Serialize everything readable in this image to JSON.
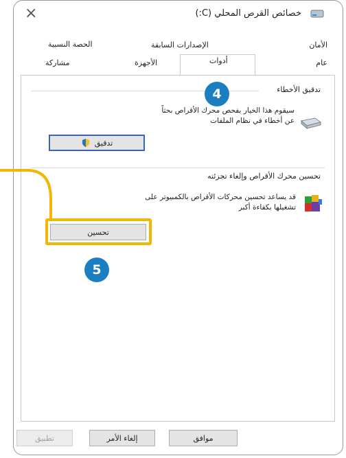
{
  "window": {
    "title": "خصائص القرص المحلي (C:)",
    "close_glyph": "×"
  },
  "tabs": {
    "row1": [
      {
        "id": "security",
        "label": "الأمان"
      },
      {
        "id": "previous_versions",
        "label": "الإصدارات السابقة"
      },
      {
        "id": "quota",
        "label": "الحصة النسبية"
      }
    ],
    "row2": [
      {
        "id": "general",
        "label": "عام"
      },
      {
        "id": "tools",
        "label": "أدوات",
        "active": true
      },
      {
        "id": "hardware",
        "label": "الأجهزة"
      },
      {
        "id": "sharing",
        "label": "مشاركة"
      }
    ]
  },
  "error_checking": {
    "title": "تدقيق الأخطاء",
    "description_line1": "سيقوم هذا الخيار بفحص محرك الأقراص بحثاً",
    "description_line2": "عن أخطاء في نظام الملفات",
    "button_label": "تدقيق"
  },
  "optimize": {
    "title": "تحسين محرك الأقراص وإلغاء تجزئته",
    "description_line1": "قد يساعد تحسين محركات الأقراص بالكمبيوتر على",
    "description_line2": "تشغيلها بكفاءة أكبر",
    "button_label": "تحسين"
  },
  "footer": {
    "ok_label": "موافق",
    "cancel_label": "إلغاء الأمر",
    "apply_label": "تطبيق"
  },
  "annotations": {
    "step4": "4",
    "step5": "5",
    "highlight_color": "#f2b705",
    "badge_color": "#1a7fc1"
  }
}
